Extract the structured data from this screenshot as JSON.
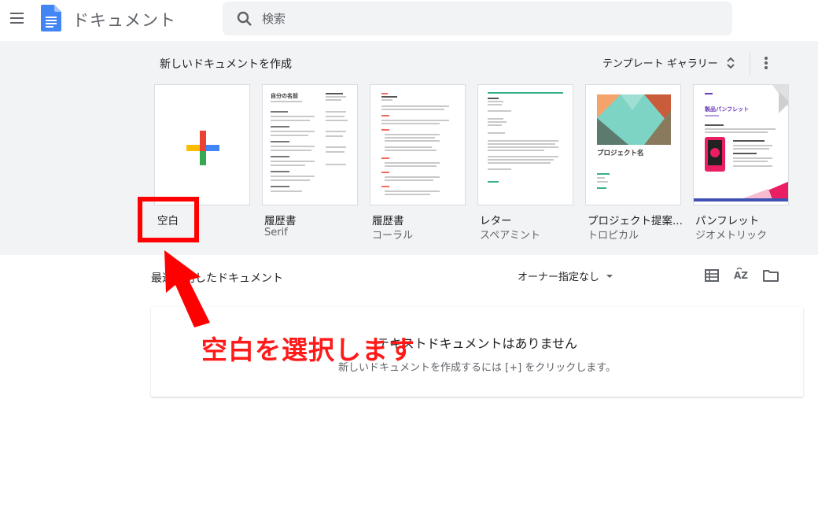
{
  "header": {
    "menu_icon": "hamburger-menu-icon",
    "logo_icon": "google-docs-icon",
    "app_title": "ドキュメント",
    "search_placeholder": "検索",
    "search_icon": "search-icon"
  },
  "gallery": {
    "title": "新しいドキュメントを作成",
    "toggle_label": "テンプレート ギャラリー",
    "templates": [
      {
        "name": "空白",
        "sub": ""
      },
      {
        "name": "履歴書",
        "sub": "Serif",
        "thumb_heading": "自分の名前"
      },
      {
        "name": "履歴書",
        "sub": "コーラル"
      },
      {
        "name": "レター",
        "sub": "スペアミント"
      },
      {
        "name": "プロジェクト提案...",
        "sub": "トロピカル",
        "thumb_heading": "プロジェクト名"
      },
      {
        "name": "パンフレット",
        "sub": "ジオメトリック",
        "thumb_heading": "製品パンフレット"
      }
    ]
  },
  "recent": {
    "title": "最近使用したドキュメント",
    "owner_filter": "オーナー指定なし",
    "sort_label": "AZ",
    "empty_title": "テキストドキュメントはありません",
    "empty_sub": "新しいドキュメントを作成するには [+] をクリックします。"
  },
  "annotation": {
    "callout": "空白を選択します",
    "color": "#ff0000"
  },
  "colors": {
    "docs_blue": "#4285f4",
    "plus_red": "#ea4335",
    "plus_yellow": "#fbbc04",
    "plus_green": "#34a853",
    "plus_blue": "#4285f4",
    "spearmint": "#34b28a",
    "coral": "#f46b5d",
    "tropical_teal": "#7dd3c4",
    "geometric_purple": "#673ab7"
  }
}
